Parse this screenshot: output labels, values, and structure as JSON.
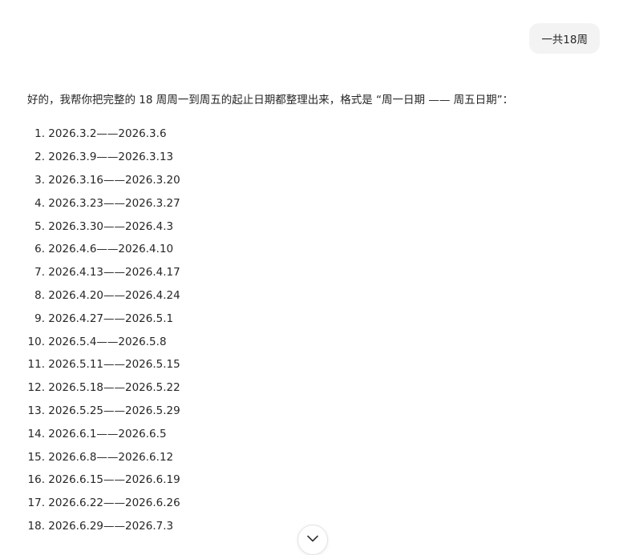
{
  "user_message": {
    "text": "一共18周"
  },
  "assistant_message": {
    "intro": "好的，我帮你把完整的 18 周周一到周五的起止日期都整理出来，格式是 “周一日期 —— 周五日期”：",
    "weeks": [
      {
        "num": "1.",
        "range": "2026.3.2——2026.3.6"
      },
      {
        "num": "2.",
        "range": "2026.3.9——2026.3.13"
      },
      {
        "num": "3.",
        "range": "2026.3.16——2026.3.20"
      },
      {
        "num": "4.",
        "range": "2026.3.23——2026.3.27"
      },
      {
        "num": "5.",
        "range": "2026.3.30——2026.4.3"
      },
      {
        "num": "6.",
        "range": "2026.4.6——2026.4.10"
      },
      {
        "num": "7.",
        "range": "2026.4.13——2026.4.17"
      },
      {
        "num": "8.",
        "range": "2026.4.20——2026.4.24"
      },
      {
        "num": "9.",
        "range": "2026.4.27——2026.5.1"
      },
      {
        "num": "10.",
        "range": "2026.5.4——2026.5.8"
      },
      {
        "num": "11.",
        "range": "2026.5.11——2026.5.15"
      },
      {
        "num": "12.",
        "range": "2026.5.18——2026.5.22"
      },
      {
        "num": "13.",
        "range": "2026.5.25——2026.5.29"
      },
      {
        "num": "14.",
        "range": "2026.6.1——2026.6.5"
      },
      {
        "num": "15.",
        "range": "2026.6.8——2026.6.12"
      },
      {
        "num": "16.",
        "range": "2026.6.15——2026.6.19"
      },
      {
        "num": "17.",
        "range": "2026.6.22——2026.6.26"
      },
      {
        "num": "18.",
        "range": "2026.6.29——2026.7.3"
      }
    ]
  },
  "scroll_button": {
    "icon": "chevron-down-icon"
  }
}
